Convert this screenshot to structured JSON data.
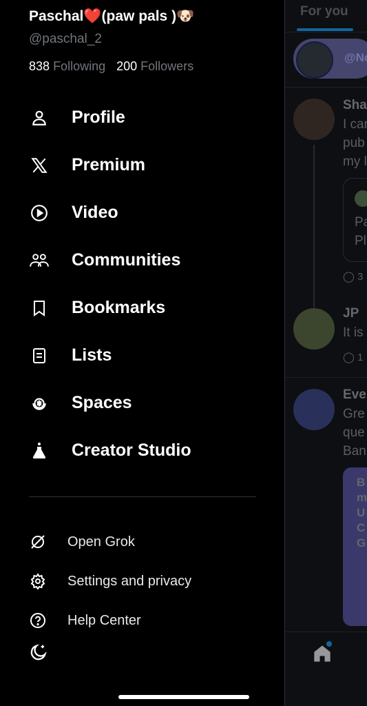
{
  "profile": {
    "name_prefix": "Paschal",
    "heart": "❤️",
    "name_suffix": "(paw pals )",
    "emoji": "🐶",
    "handle": "@paschal_2",
    "following_count": "838",
    "following_label": "Following",
    "followers_count": "200",
    "followers_label": "Followers"
  },
  "menu": [
    {
      "label": "Profile",
      "icon": "person-icon"
    },
    {
      "label": "Premium",
      "icon": "x-logo-icon"
    },
    {
      "label": "Video",
      "icon": "play-circle-icon"
    },
    {
      "label": "Communities",
      "icon": "people-icon"
    },
    {
      "label": "Bookmarks",
      "icon": "bookmark-icon"
    },
    {
      "label": "Lists",
      "icon": "list-icon"
    },
    {
      "label": "Spaces",
      "icon": "spaces-mic-icon"
    },
    {
      "label": "Creator Studio",
      "icon": "flask-icon"
    }
  ],
  "secondary": [
    {
      "label": "Open Grok",
      "icon": "grok-icon"
    },
    {
      "label": "Settings and privacy",
      "icon": "gear-icon"
    },
    {
      "label": "Help Center",
      "icon": "help-icon"
    }
  ],
  "theme_toggle_icon": "moon-icon",
  "feed": {
    "tab_label": "For you",
    "pill_text": "@No",
    "post1": {
      "author": "Sha",
      "lines": [
        "I car",
        "pub",
        "my l"
      ],
      "quote_lines": [
        "Pa",
        "Pl"
      ],
      "reply_count": "3"
    },
    "post2": {
      "author": "JP",
      "lines": [
        "It is"
      ],
      "reply_count": "1"
    },
    "post3": {
      "author": "Eve",
      "lines": [
        "Gre",
        "que",
        "Ban"
      ],
      "card_lines": [
        "B",
        "m",
        "U",
        "C",
        "G"
      ]
    }
  },
  "colors": {
    "accent": "#1d9bf0",
    "heart": "#e0245e",
    "purple": "#5b56a6"
  }
}
